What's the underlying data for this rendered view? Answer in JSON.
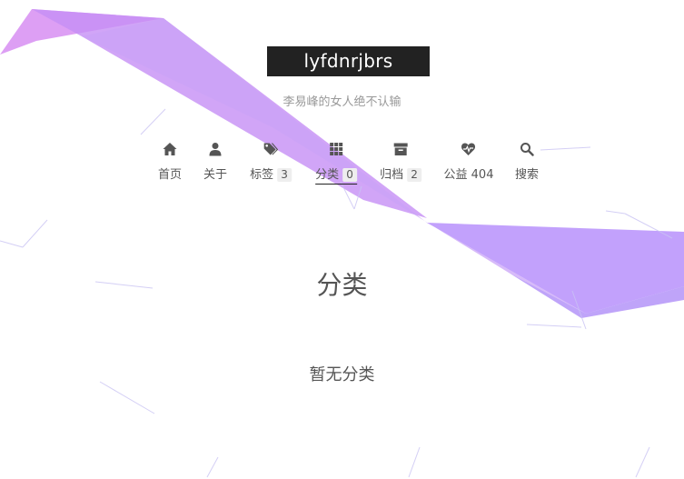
{
  "site": {
    "title": "lyfdnrjbrs",
    "subtitle": "李易峰的女人绝不认输"
  },
  "menu": [
    {
      "id": "home",
      "icon": "home-icon",
      "label": "首页",
      "badge": ""
    },
    {
      "id": "about",
      "icon": "user-icon",
      "label": "关于",
      "badge": ""
    },
    {
      "id": "tags",
      "icon": "tags-icon",
      "label": "标签",
      "badge": "3"
    },
    {
      "id": "categories",
      "icon": "th-icon",
      "label": "分类",
      "badge": "0",
      "active": true
    },
    {
      "id": "archives",
      "icon": "archive-icon",
      "label": "归档",
      "badge": "2"
    },
    {
      "id": "commonweal",
      "icon": "heartbeat-icon",
      "label": "公益 404",
      "badge": ""
    },
    {
      "id": "search",
      "icon": "search-icon",
      "label": "搜索",
      "badge": ""
    }
  ],
  "main": {
    "title": "分类",
    "empty_text": "暂无分类"
  },
  "colors": {
    "ribbon": "#b98cf5",
    "brand_bg": "#222222"
  }
}
